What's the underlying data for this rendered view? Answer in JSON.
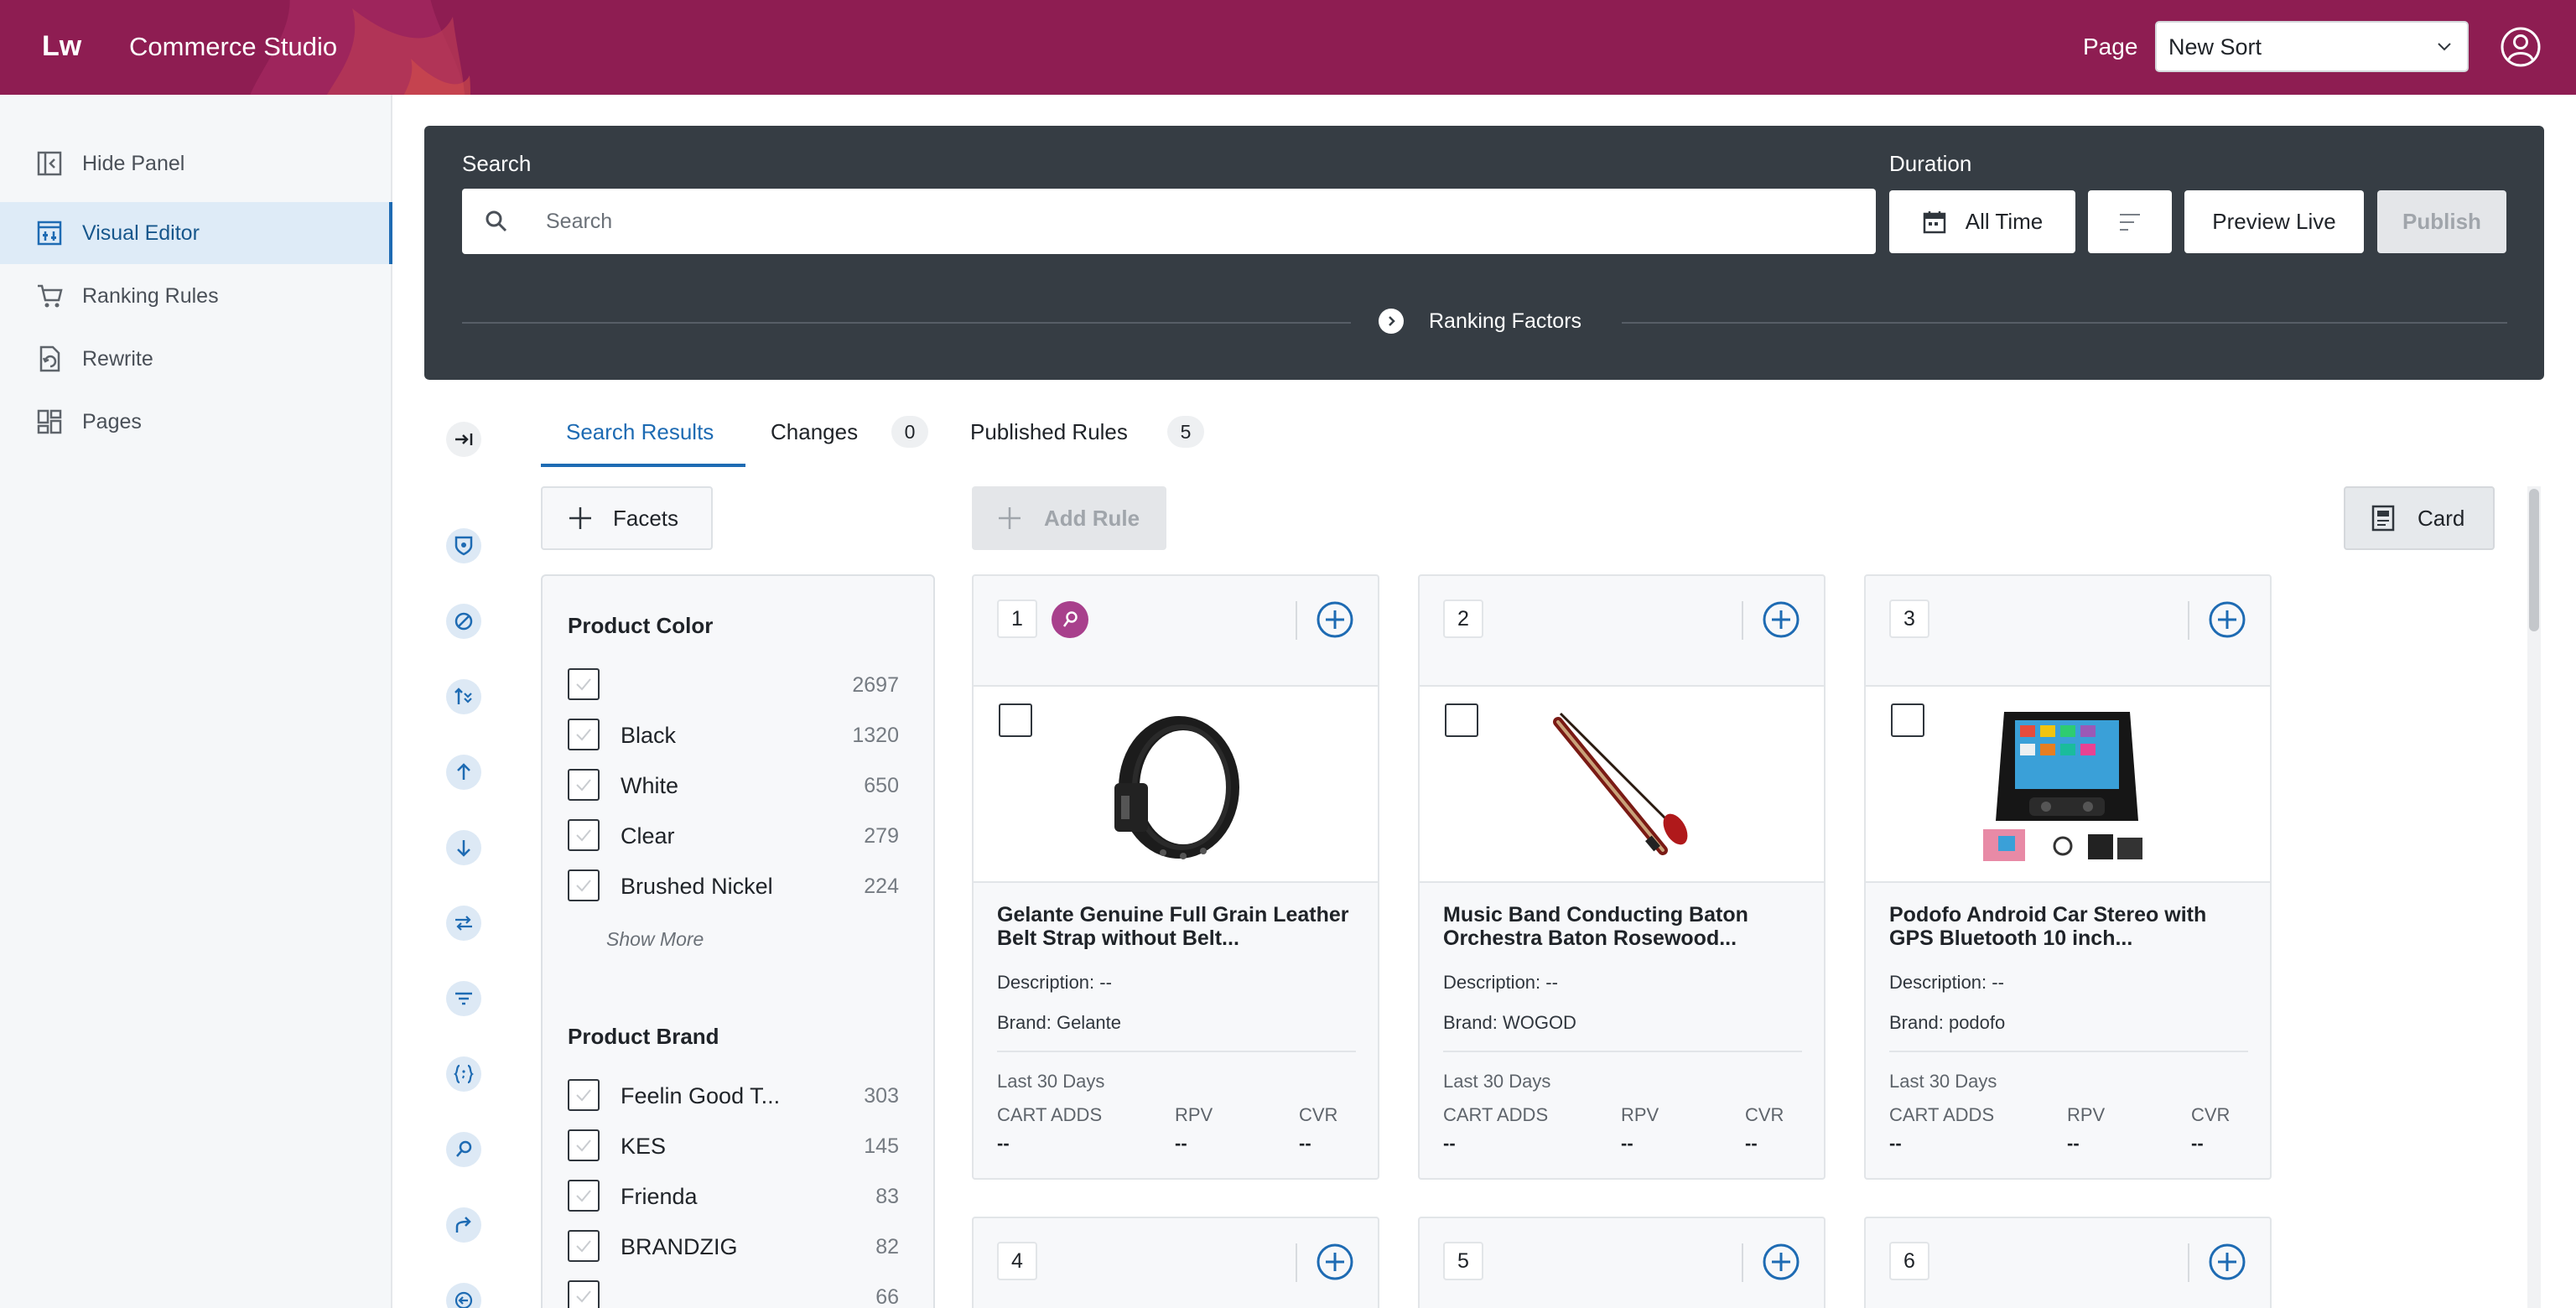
{
  "header": {
    "logo": "Lw",
    "app_title": "Commerce Studio",
    "page_label": "Page",
    "page_select_value": "New Sort",
    "brand_color": "#8e1d52"
  },
  "sidebar": {
    "hide_panel": "Hide Panel",
    "items": [
      {
        "label": "Visual Editor",
        "icon": "visual-editor-icon",
        "active": true
      },
      {
        "label": "Ranking Rules",
        "icon": "cart-icon"
      },
      {
        "label": "Rewrite",
        "icon": "rewrite-icon"
      },
      {
        "label": "Pages",
        "icon": "pages-icon"
      }
    ]
  },
  "search_panel": {
    "search_label": "Search",
    "search_placeholder": "Search",
    "duration_label": "Duration",
    "duration_value": "All Time",
    "preview_live": "Preview Live",
    "publish": "Publish",
    "ranking_factors": "Ranking Factors"
  },
  "tabs": {
    "search_results": "Search Results",
    "changes": "Changes",
    "changes_count": "0",
    "published_rules": "Published Rules",
    "published_count": "5"
  },
  "toolbar": {
    "facets": "Facets",
    "add_rule": "Add Rule",
    "card": "Card"
  },
  "facets": {
    "product_color": {
      "title": "Product Color",
      "rows": [
        {
          "name": "",
          "count": "2697"
        },
        {
          "name": "Black",
          "count": "1320"
        },
        {
          "name": "White",
          "count": "650"
        },
        {
          "name": "Clear",
          "count": "279"
        },
        {
          "name": "Brushed Nickel",
          "count": "224"
        }
      ],
      "show_more": "Show More"
    },
    "product_brand": {
      "title": "Product Brand",
      "rows": [
        {
          "name": "Feelin Good T...",
          "count": "303"
        },
        {
          "name": "KES",
          "count": "145"
        },
        {
          "name": "Frienda",
          "count": "83"
        },
        {
          "name": "BRANDZIG",
          "count": "82"
        },
        {
          "name": "",
          "count": "66"
        }
      ]
    }
  },
  "products": [
    {
      "rank": "1",
      "pinned": true,
      "title": "Gelante Genuine Full Grain Leather Belt Strap without Belt...",
      "description_label": "Description:",
      "description": "--",
      "brand_label": "Brand:",
      "brand": "Gelante",
      "period": "Last 30 Days",
      "metrics": [
        {
          "label": "CART ADDS",
          "value": "--"
        },
        {
          "label": "RPV",
          "value": "--"
        },
        {
          "label": "CVR",
          "value": "--"
        }
      ],
      "image": "belt"
    },
    {
      "rank": "2",
      "pinned": false,
      "title": "Music Band Conducting Baton Orchestra Baton Rosewood...",
      "description_label": "Description:",
      "description": "--",
      "brand_label": "Brand:",
      "brand": "WOGOD",
      "period": "Last 30 Days",
      "metrics": [
        {
          "label": "CART ADDS",
          "value": "--"
        },
        {
          "label": "RPV",
          "value": "--"
        },
        {
          "label": "CVR",
          "value": "--"
        }
      ],
      "image": "baton"
    },
    {
      "rank": "3",
      "pinned": false,
      "title": "Podofo Android Car Stereo with GPS Bluetooth 10 inch...",
      "description_label": "Description:",
      "description": "--",
      "brand_label": "Brand:",
      "brand": "podofo",
      "period": "Last 30 Days",
      "metrics": [
        {
          "label": "CART ADDS",
          "value": "--"
        },
        {
          "label": "RPV",
          "value": "--"
        },
        {
          "label": "CVR",
          "value": "--"
        }
      ],
      "image": "stereo"
    },
    {
      "rank": "4"
    },
    {
      "rank": "5"
    },
    {
      "rank": "6"
    }
  ]
}
